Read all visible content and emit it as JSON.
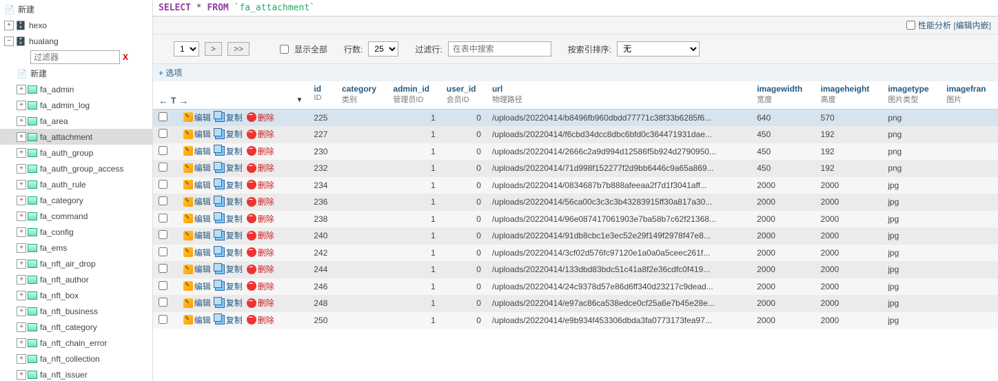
{
  "sidebar": {
    "top_item": "新建",
    "databases": [
      {
        "name": "hexo",
        "expanded": false,
        "expand": "+"
      },
      {
        "name": "hualang",
        "expanded": true,
        "expand": "−"
      }
    ],
    "filter_placeholder": "过滤器",
    "new_label": "新建",
    "tables": [
      "fa_admin",
      "fa_admin_log",
      "fa_area",
      "fa_attachment",
      "fa_auth_group",
      "fa_auth_group_access",
      "fa_auth_rule",
      "fa_category",
      "fa_command",
      "fa_config",
      "fa_ems",
      "fa_nft_air_drop",
      "fa_nft_author",
      "fa_nft_box",
      "fa_nft_business",
      "fa_nft_category",
      "fa_nft_chain_error",
      "fa_nft_collection",
      "fa_nft_issuer"
    ],
    "selected_table": "fa_attachment"
  },
  "sql": {
    "select": "SELECT",
    "star": "*",
    "from": "FROM",
    "table": "`fa_attachment`"
  },
  "perf": {
    "profiling": "性能分析",
    "edit_inline": "编辑内嵌"
  },
  "controls": {
    "page_value": "1",
    "next": ">",
    "last": ">>",
    "show_all": "显示全部",
    "rows_label": "行数:",
    "rows_value": "25",
    "filter_label": "过滤行:",
    "filter_placeholder": "在表中搜索",
    "sort_label": "按索引排序:",
    "sort_value": "无"
  },
  "options": {
    "plus": "+",
    "label": "选项"
  },
  "columns": [
    {
      "name": "id",
      "sub": "ID"
    },
    {
      "name": "category",
      "sub": "类别"
    },
    {
      "name": "admin_id",
      "sub": "管理员ID"
    },
    {
      "name": "user_id",
      "sub": "会员ID"
    },
    {
      "name": "url",
      "sub": "物理路径"
    },
    {
      "name": "imagewidth",
      "sub": "宽度"
    },
    {
      "name": "imageheight",
      "sub": "高度"
    },
    {
      "name": "imagetype",
      "sub": "图片类型"
    },
    {
      "name": "imagefran",
      "sub": "图片"
    }
  ],
  "actions": {
    "edit": "编辑",
    "copy": "复制",
    "delete": "删除"
  },
  "rows": [
    {
      "id": "225",
      "category": "",
      "admin_id": "1",
      "user_id": "0",
      "url": "/uploads/20220414/b8496fb960dbdd77771c38f33b6285f6...",
      "w": "640",
      "h": "570",
      "t": "png",
      "sel": true
    },
    {
      "id": "227",
      "category": "",
      "admin_id": "1",
      "user_id": "0",
      "url": "/uploads/20220414/f6cbd34dcc8dbc6bfd0c364471931dae...",
      "w": "450",
      "h": "192",
      "t": "png"
    },
    {
      "id": "230",
      "category": "",
      "admin_id": "1",
      "user_id": "0",
      "url": "/uploads/20220414/2666c2a9d994d12586f5b924d2790950...",
      "w": "450",
      "h": "192",
      "t": "png"
    },
    {
      "id": "232",
      "category": "",
      "admin_id": "1",
      "user_id": "0",
      "url": "/uploads/20220414/71d998f152277f2d9bb6446c9a65a869...",
      "w": "450",
      "h": "192",
      "t": "png"
    },
    {
      "id": "234",
      "category": "",
      "admin_id": "1",
      "user_id": "0",
      "url": "/uploads/20220414/0834687b7b888afeeaa2f7d1f3041aff...",
      "w": "2000",
      "h": "2000",
      "t": "jpg"
    },
    {
      "id": "236",
      "category": "",
      "admin_id": "1",
      "user_id": "0",
      "url": "/uploads/20220414/56ca00c3c3c3b43283915ff30a817a30...",
      "w": "2000",
      "h": "2000",
      "t": "jpg"
    },
    {
      "id": "238",
      "category": "",
      "admin_id": "1",
      "user_id": "0",
      "url": "/uploads/20220414/96e087417061903e7ba58b7c62f21368...",
      "w": "2000",
      "h": "2000",
      "t": "jpg"
    },
    {
      "id": "240",
      "category": "",
      "admin_id": "1",
      "user_id": "0",
      "url": "/uploads/20220414/91db8cbc1e3ec52e29f149f2978f47e8...",
      "w": "2000",
      "h": "2000",
      "t": "jpg"
    },
    {
      "id": "242",
      "category": "",
      "admin_id": "1",
      "user_id": "0",
      "url": "/uploads/20220414/3cf02d576fc97120e1a0a0a5ceec261f...",
      "w": "2000",
      "h": "2000",
      "t": "jpg"
    },
    {
      "id": "244",
      "category": "",
      "admin_id": "1",
      "user_id": "0",
      "url": "/uploads/20220414/133dbd83bdc51c41a8f2e36cdfc0f419...",
      "w": "2000",
      "h": "2000",
      "t": "jpg"
    },
    {
      "id": "246",
      "category": "",
      "admin_id": "1",
      "user_id": "0",
      "url": "/uploads/20220414/24c9378d57e86d6ff340d23217c9dead...",
      "w": "2000",
      "h": "2000",
      "t": "jpg"
    },
    {
      "id": "248",
      "category": "",
      "admin_id": "1",
      "user_id": "0",
      "url": "/uploads/20220414/e97ac86ca538edce0cf25a6e7b45e28e...",
      "w": "2000",
      "h": "2000",
      "t": "jpg"
    },
    {
      "id": "250",
      "category": "",
      "admin_id": "1",
      "user_id": "0",
      "url": "/uploads/20220414/e9b934f453306dbda3fa0773173fea97...",
      "w": "2000",
      "h": "2000",
      "t": "jpg"
    }
  ]
}
